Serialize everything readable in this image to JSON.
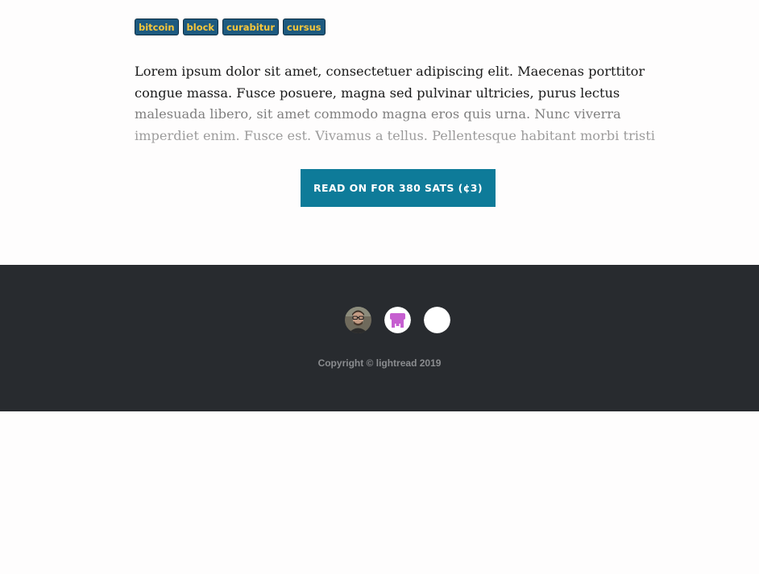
{
  "tags": [
    "bitcoin",
    "block",
    "curabitur",
    "cursus"
  ],
  "excerpt": "Lorem ipsum dolor sit amet, consectetuer adipiscing elit. Maecenas porttitor congue massa. Fusce posuere, magna sed pulvinar ultricies, purus lectus malesuada libero, sit amet commodo magna eros quis urna. Nunc viverra imperdiet enim. Fusce est. Vivamus a tellus. Pellentesque habitant morbi tristi",
  "read_button": "READ ON FOR 380 SATS (¢3)",
  "footer": {
    "avatars": [
      {
        "name": "author-avatar-icon"
      },
      {
        "name": "pink-robot-avatar-icon"
      },
      {
        "name": "white-circle-avatar-icon"
      }
    ],
    "copyright": "Copyright © lightread 2019"
  },
  "colors": {
    "tag_bg": "#1d5a80",
    "tag_text": "#f6c63b",
    "button_bg": "#0e7b99",
    "footer_bg": "#282b2f"
  }
}
